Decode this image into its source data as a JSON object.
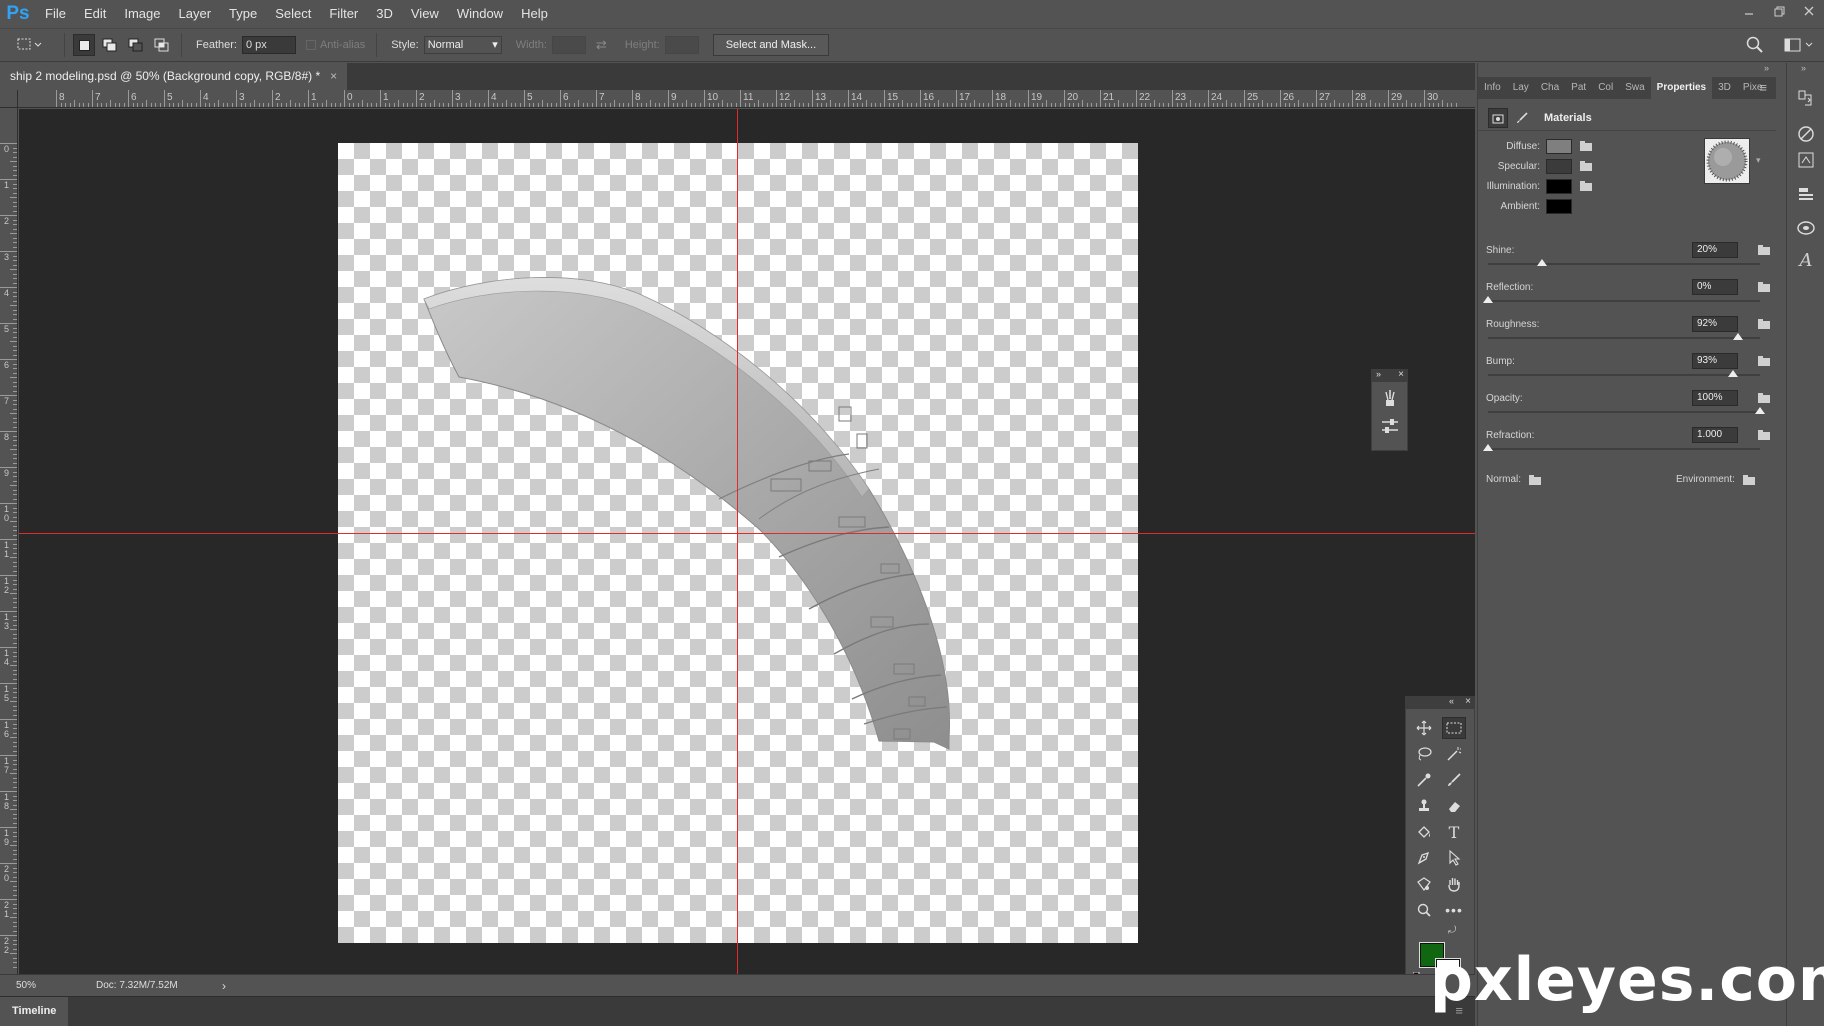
{
  "app": {
    "logo": "Ps"
  },
  "menu": [
    "File",
    "Edit",
    "Image",
    "Layer",
    "Type",
    "Select",
    "Filter",
    "3D",
    "View",
    "Window",
    "Help"
  ],
  "window_controls": [
    "minimize",
    "restore",
    "close"
  ],
  "options_bar": {
    "feather_label": "Feather:",
    "feather_value": "0 px",
    "antialias_label": "Anti-alias",
    "style_label": "Style:",
    "style_value": "Normal",
    "width_label": "Width:",
    "height_label": "Height:",
    "select_mask_button": "Select and Mask..."
  },
  "document": {
    "tab_title": "ship 2 modeling.psd @ 50% (Background copy, RGB/8#) *",
    "close": "×"
  },
  "ruler_top": [
    "8",
    "7",
    "6",
    "5",
    "4",
    "3",
    "2",
    "1",
    "0",
    "1",
    "2",
    "3",
    "4",
    "5",
    "6",
    "7",
    "8",
    "9",
    "10",
    "11",
    "12",
    "13",
    "14",
    "15",
    "16",
    "17",
    "18",
    "19",
    "20",
    "21",
    "22",
    "23",
    "24",
    "25",
    "26",
    "27",
    "28",
    "29",
    "30"
  ],
  "ruler_left": [
    "0",
    "1",
    "2",
    "3",
    "4",
    "5",
    "6",
    "7",
    "8",
    "9",
    "1 0",
    "1 1",
    "1 2",
    "1 3",
    "1 4",
    "1 5",
    "1 6",
    "1 7",
    "1 8",
    "1 9",
    "2 0",
    "2 1",
    "2 2"
  ],
  "status": {
    "zoom": "50%",
    "doc_size": "Doc: 7.32M/7.52M",
    "arrow": "›"
  },
  "timeline": {
    "tab": "Timeline"
  },
  "panel_tabs": [
    "Info",
    "Lay",
    "Cha",
    "Pat",
    "Col",
    "Swa",
    "Properties",
    "3D",
    "Pixe"
  ],
  "properties": {
    "section_title": "Materials",
    "materials": [
      {
        "label": "Diffuse:",
        "color": "#7f7f7f"
      },
      {
        "label": "Specular:",
        "color": "#3b3b3b"
      },
      {
        "label": "Illumination:",
        "color": "#000000"
      },
      {
        "label": "Ambient:",
        "color": "#000000"
      }
    ],
    "sliders": [
      {
        "label": "Shine:",
        "value": "20%",
        "fraction": 0.2
      },
      {
        "label": "Reflection:",
        "value": "0%",
        "fraction": 0.0
      },
      {
        "label": "Roughness:",
        "value": "92%",
        "fraction": 0.92
      },
      {
        "label": "Bump:",
        "value": "93%",
        "fraction": 0.9
      },
      {
        "label": "Opacity:",
        "value": "100%",
        "fraction": 1.0
      },
      {
        "label": "Refraction:",
        "value": "1.000",
        "fraction": 0.0
      }
    ],
    "normal_label": "Normal:",
    "environment_label": "Environment:"
  },
  "colors": {
    "foreground": "#116611",
    "background": "#ffffff",
    "guide": "#e22a2a",
    "accent": "#2fa3f5"
  },
  "char_panel": {
    "icons": [
      "character-icon",
      "paragraph-icon"
    ]
  },
  "watermark": "pxleyes.com"
}
